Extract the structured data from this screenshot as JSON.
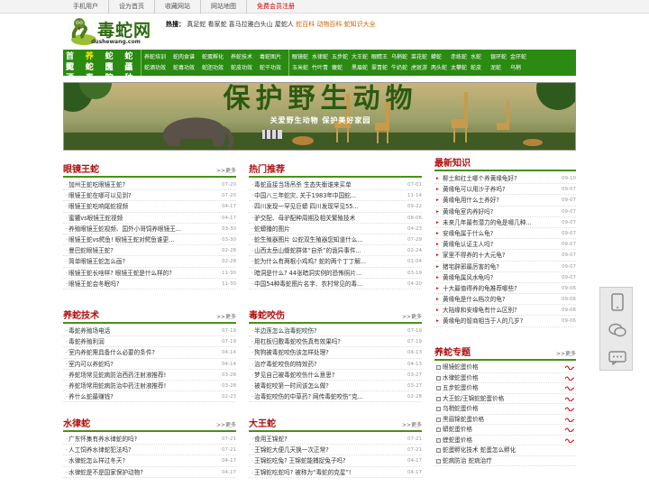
{
  "topbar": {
    "links": [
      "手机用户",
      "设为首页",
      "收藏网站",
      "网站地图",
      "免费会员注册"
    ]
  },
  "logo": {
    "title": "毒蛇网",
    "url": "dushewang.com"
  },
  "hot": {
    "label": "热搜：",
    "items": "真足蛇 看家蛇 喜马拉雅白头山 屋蛇人",
    "highlight": "蛇百科 动物百科 蛇知识大全"
  },
  "nav": {
    "main_row1": [
      "首页",
      "养蛇",
      "蛇肉",
      "蛇蛋"
    ],
    "main_row2": [
      "蛇酒",
      "蛇毒",
      "医院",
      "品种"
    ],
    "grid1_row1": [
      "养蛇培训",
      "蛇肉食谱",
      "蛇蛋孵化",
      "养蛇技术",
      "毒蛇图片"
    ],
    "grid1_row2": [
      "蛇酒功效",
      "蛇毒功效",
      "蛇胆功效",
      "蛇皮功效",
      "蛇干功效"
    ],
    "grid2_row1": [
      "眼镜蛇",
      "水律蛇",
      "五步蛇",
      "大王蛇",
      "眼睛王",
      "乌梢蛇",
      "菜花蛇",
      "蟒蛇",
      "赤练蛇",
      "水蛇",
      "银环蛇",
      "金环蛇"
    ],
    "grid2_row2": [
      "玉米蛇",
      "竹叶青",
      "蝮蛇",
      "黑眉蛇",
      "翠青蛇",
      "牛奶蛇",
      "虎斑游",
      "两头蛇",
      "太攀蛇",
      "蛇皮",
      "泥蛇",
      "乌梢"
    ]
  },
  "banner": {
    "title": "保护野生动物",
    "slogan": "关爱野生动物 保护美好家园"
  },
  "sections": {
    "eyeking": {
      "title": "眼镜王蛇",
      "more": ">>更多",
      "items": [
        {
          "t": "加州王蛇吃眼镜王蛇?",
          "d": "07-20"
        },
        {
          "t": "眼镜王蛇在哪可以见到?",
          "d": "07-20"
        },
        {
          "t": "眼镜王蛇吃响尾蛇视频",
          "d": "04-17"
        },
        {
          "t": "蜜獾vs眼镜王蛇视频",
          "d": "04-17"
        },
        {
          "t": "养殖眼镜王蛇视频、国外小哥饲养眼镜王...",
          "d": "03-30"
        },
        {
          "t": "眼镜王蛇vs鳄鱼! 眼镜王蛇对鳄鱼谁更...",
          "d": "03-30"
        },
        {
          "t": "曼巴蛇眼镜王蛇?",
          "d": "02-28"
        },
        {
          "t": "简单眼镜王蛇怎么画?",
          "d": "02-28"
        },
        {
          "t": "眼镜王蛇长啥样? 眼镜王蛇是什么样的?",
          "d": "11-30"
        },
        {
          "t": "眼镜王蛇会冬眠吗?",
          "d": "11-30"
        }
      ]
    },
    "hot": {
      "title": "热门推荐",
      "more": "",
      "items": [
        {
          "t": "毒蛇直接当场吊杀 生态失衡谁来买单",
          "d": "07-01"
        },
        {
          "t": "中国八三年蛇灾, 关于1983年中国蛇...",
          "d": "11-14"
        },
        {
          "t": "四川发现一罕见巨蟒 四川发现罕见55...",
          "d": "09-22"
        },
        {
          "t": "驴交配、母驴配种周期及相关繁殖技术",
          "d": "08-06"
        },
        {
          "t": "蛇蟒播的图片",
          "d": "04-23"
        },
        {
          "t": "蛇生殖器图片 公蛇双生殖器您知道什么...",
          "d": "07-29"
        },
        {
          "t": "山西太岳山蝮蛇群体“自杀”的诡异事件...",
          "d": "02-24"
        },
        {
          "t": "蛇为什么有两根小鸡鸡? 蛇的两个丁丁解...",
          "d": "01-04"
        },
        {
          "t": "暗洞是什么? 44张暗洞实例的恐怖照片...",
          "d": "03-19"
        },
        {
          "t": "中国54种毒蛇图片名字、农村常见的毒...",
          "d": "04-20"
        }
      ]
    },
    "latest": {
      "title": "最新知识",
      "items": [
        {
          "t": "柳土和红土哪个养黄缘龟好?",
          "d": "09-10"
        },
        {
          "t": "黄缘龟可以用沙子养吗?",
          "d": "09-07"
        },
        {
          "t": "黄缘龟用什么土养好?",
          "d": "09-07"
        },
        {
          "t": "黄缘龟室内养好吗?",
          "d": "09-07"
        },
        {
          "t": "未来几年最有潜力的龟是哪几种...",
          "d": "09-07"
        },
        {
          "t": "安缘龟属于什么龟?",
          "d": "09-07"
        },
        {
          "t": "黄缘龟认证主人吗?",
          "d": "09-07"
        },
        {
          "t": "家里不得养的十大元龟?",
          "d": "09-07"
        },
        {
          "t": "猪宅辟邪最厉害的龟?",
          "d": "09-07"
        },
        {
          "t": "黄缘龟属风水龟吗?",
          "d": "09-07"
        },
        {
          "t": "十大最值得养的龟推荐哪些?",
          "d": "09-06"
        },
        {
          "t": "黄缘龟是什么档次的龟?",
          "d": "09-06"
        },
        {
          "t": "大陆缘和安缘龟有什么区别?",
          "d": "09-06"
        },
        {
          "t": "黄缘龟的智商相当于人的几岁?",
          "d": "09-06"
        }
      ]
    },
    "tech": {
      "title": "养蛇技术",
      "more": ">>更多",
      "items": [
        {
          "t": "毒蛇养殖场电话",
          "d": "07-19"
        },
        {
          "t": "毒蛇养殖利润",
          "d": "07-19"
        },
        {
          "t": "室内养蛇需具备什么必要的条件?",
          "d": "04-14"
        },
        {
          "t": "室内可以养蛇吗?",
          "d": "04-14"
        },
        {
          "t": "养蛇场常见蛇病防治西药注射液推荐!",
          "d": "03-28"
        },
        {
          "t": "养蛇场常用蛇病防治中药注射液推荐!",
          "d": "03-28"
        },
        {
          "t": "养什么蛇最赚钱?",
          "d": "02-23"
        }
      ]
    },
    "bite": {
      "title": "毒蛇咬伤",
      "more": ">>更多",
      "items": [
        {
          "t": "半边莲怎么治毒蛇咬伤?",
          "d": "07-19"
        },
        {
          "t": "用杠板归敷毒蛇咬伤真有效果吗?",
          "d": "07-19"
        },
        {
          "t": "狗狗被毒蛇咬伤该怎样处理?",
          "d": "04-13"
        },
        {
          "t": "治疗毒蛇咬伤的特效药?",
          "d": "04-13"
        },
        {
          "t": "梦见自己被毒蛇咬伤什么意思?",
          "d": "03-27"
        },
        {
          "t": "被毒蛇咬第一时间该怎么做?",
          "d": "03-27"
        },
        {
          "t": "治毒蛇咬伤的中草药? 网传毒蛇咬伤“克...",
          "d": "02-28"
        }
      ]
    },
    "topics": {
      "title": "养蛇专题",
      "more": ">>更多",
      "items": [
        "眼镜蛇蛋价格",
        "水律蛇蛋价格",
        "五步蛇蛋价格",
        "大王蛇/王锦蛇蛇蛋价格",
        "乌梢蛇蛋价格",
        "黑眉锦蛇蛋价格",
        "蟒蛇蛋价格",
        "蝰蛇蛋价格",
        "蛇蛋孵化技术 蛇蛋怎么孵化",
        "蛇病防治 蛇病治疗"
      ]
    },
    "shuilv": {
      "title": "水律蛇",
      "more": ">>更多",
      "items": [
        {
          "t": "广东怀集有养水律蛇的吗?",
          "d": "07-21"
        },
        {
          "t": "人工饲养水律蛇犯法吗?",
          "d": "07-21"
        },
        {
          "t": "水律蛇怎么样过冬天?",
          "d": "04-17"
        },
        {
          "t": "水律蛇是不是国家保护动物?",
          "d": "04-17"
        }
      ]
    },
    "dawang": {
      "title": "大王蛇",
      "more": ">>更多",
      "items": [
        {
          "t": "食用王锦蛇?",
          "d": "07-21"
        },
        {
          "t": "王锦蛇大便几天换一次正常?",
          "d": "07-21"
        },
        {
          "t": "王锦蛇吃兔? 王锦蛇能捕捉兔子吗?",
          "d": "04-17"
        },
        {
          "t": "王锦蛇吃蛇吗? 被称为“毒蛇的克星”!",
          "d": "04-17"
        }
      ]
    }
  },
  "colors": {
    "nav_green": "#2a8a12",
    "title_red": "#b01010",
    "accent_yellow": "#ffea00"
  }
}
